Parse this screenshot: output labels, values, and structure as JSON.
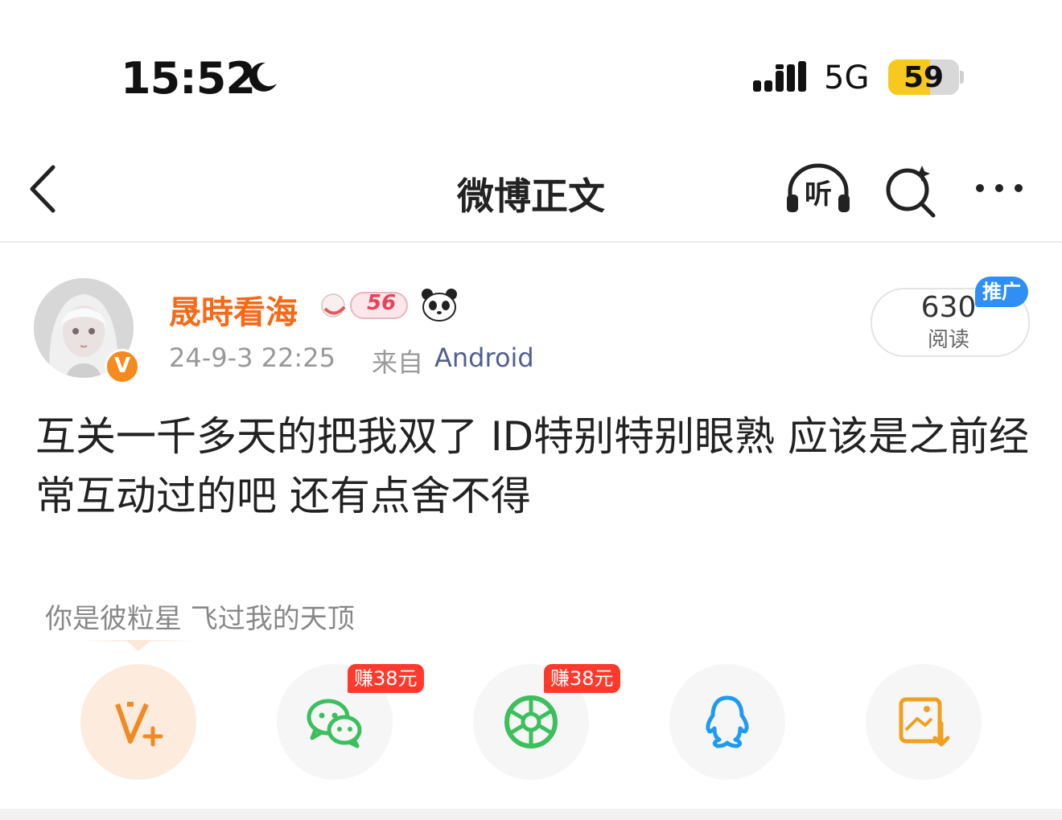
{
  "status_bar": {
    "time": "15:52",
    "network": "5G",
    "battery": "59",
    "battery_level": 0.59
  },
  "nav": {
    "title": "微博正文",
    "listen_label": "听"
  },
  "post": {
    "author": "晟時看海",
    "level_badge": "56",
    "time": "24-9-3 22:25",
    "source_prefix": "来自",
    "source": "Android",
    "reads_count": "630",
    "reads_label": "阅读",
    "promo_badge": "推广",
    "body": "互关一千多天的把我双了 ID特别特别眼熟 应该是之前经常互动过的吧 还有点舍不得"
  },
  "share": {
    "tip": "你是彼粒星 飞过我的天顶",
    "reward_wechat": "赚38元",
    "reward_moments": "赚38元",
    "targets": [
      "fans-plus",
      "wechat",
      "moments",
      "qq",
      "save-image"
    ]
  },
  "colors": {
    "author": "#f36a19",
    "source": "#51608e",
    "accent": "#f58a1f",
    "promo": "#2f8ff5",
    "reward": "#ff3a2c",
    "wechat": "#3cbf5d",
    "qq": "#1e9bf0"
  }
}
